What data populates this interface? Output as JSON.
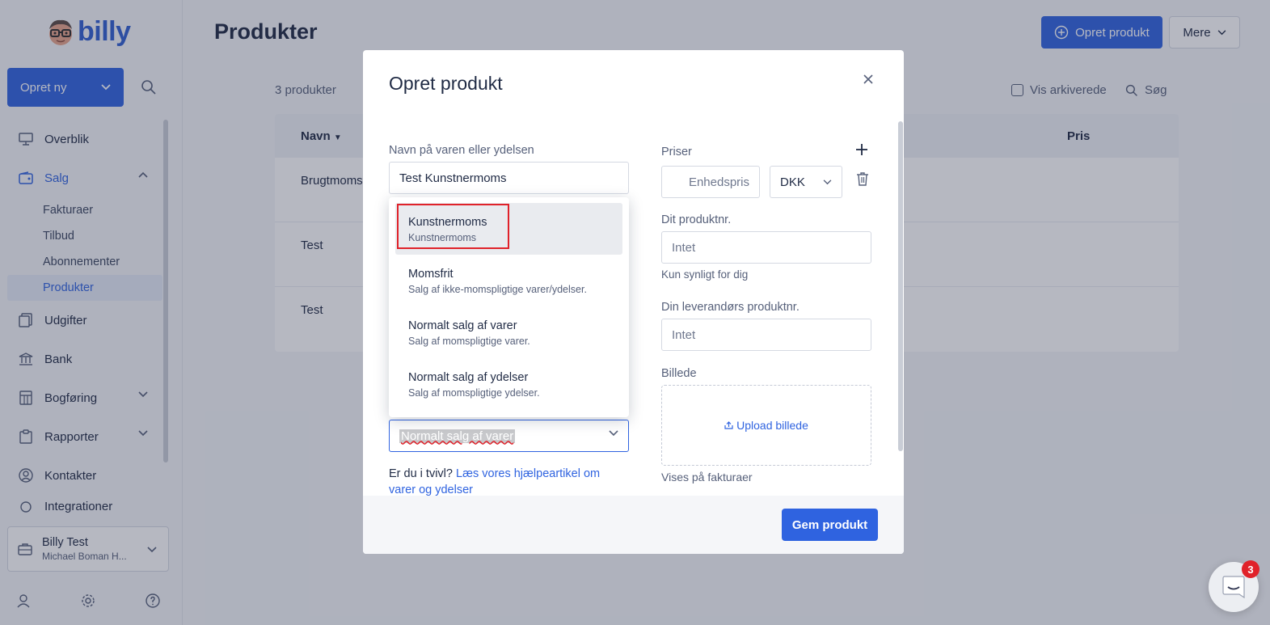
{
  "sidebar": {
    "logo_text": "billy",
    "create_button": "Opret ny",
    "nav": [
      {
        "label": "Overblik",
        "icon": "monitor-icon"
      },
      {
        "label": "Salg",
        "icon": "wallet-icon",
        "active": true,
        "expanded": true
      },
      {
        "label": "Udgifter",
        "icon": "receipt-icon"
      },
      {
        "label": "Bank",
        "icon": "bank-icon"
      },
      {
        "label": "Bogføring",
        "icon": "calculator-icon"
      },
      {
        "label": "Rapporter",
        "icon": "clipboard-icon"
      },
      {
        "label": "Kontakter",
        "icon": "contact-icon"
      },
      {
        "label": "Integrationer",
        "icon": "plug-icon"
      }
    ],
    "sub_items": [
      {
        "label": "Fakturaer"
      },
      {
        "label": "Tilbud"
      },
      {
        "label": "Abonnementer"
      },
      {
        "label": "Produkter",
        "active": true
      }
    ],
    "org": {
      "name": "Billy Test",
      "user": "Michael Boman H..."
    }
  },
  "header": {
    "title": "Produkter",
    "create_product": "Opret produkt",
    "more": "Mere"
  },
  "list": {
    "count": "3 produkter",
    "show_archived": "Vis arkiverede",
    "search": "Søg",
    "columns": {
      "name": "Navn",
      "price": "Pris"
    },
    "rows": [
      "Brugtmoms",
      "Test",
      "Test"
    ]
  },
  "modal": {
    "title": "Opret produkt",
    "name_label": "Navn på varen eller ydelsen",
    "name_value": "Test Kunstnermoms",
    "dropdown_options": [
      {
        "title": "Kunstnermoms",
        "desc": "Kunstnermoms"
      },
      {
        "title": "Momsfrit",
        "desc": "Salg af ikke-momspligtige varer/ydelser."
      },
      {
        "title": "Normalt salg af varer",
        "desc": "Salg af momspligtige varer."
      },
      {
        "title": "Normalt salg af ydelser",
        "desc": "Salg af momspligtige ydelser."
      }
    ],
    "select_value": "Normalt salg af varer",
    "help_prefix": "Er du i tvivl?",
    "help_link": "Læs vores hjælpeartikel om varer og ydelser",
    "prices_label": "Priser",
    "unit_price_placeholder": "Enhedspris",
    "currency": "DKK",
    "product_no_label": "Dit produktnr.",
    "product_no_placeholder": "Intet",
    "product_no_hint": "Kun synligt for dig",
    "supplier_no_label": "Din leverandørs produktnr.",
    "supplier_no_placeholder": "Intet",
    "image_label": "Billede",
    "upload_label": "Upload billede",
    "image_hint": "Vises på fakturaer",
    "save_button": "Gem produkt"
  },
  "chat": {
    "badge": "3"
  },
  "colors": {
    "accent": "#2f63e0",
    "highlight": "#e0222a"
  }
}
